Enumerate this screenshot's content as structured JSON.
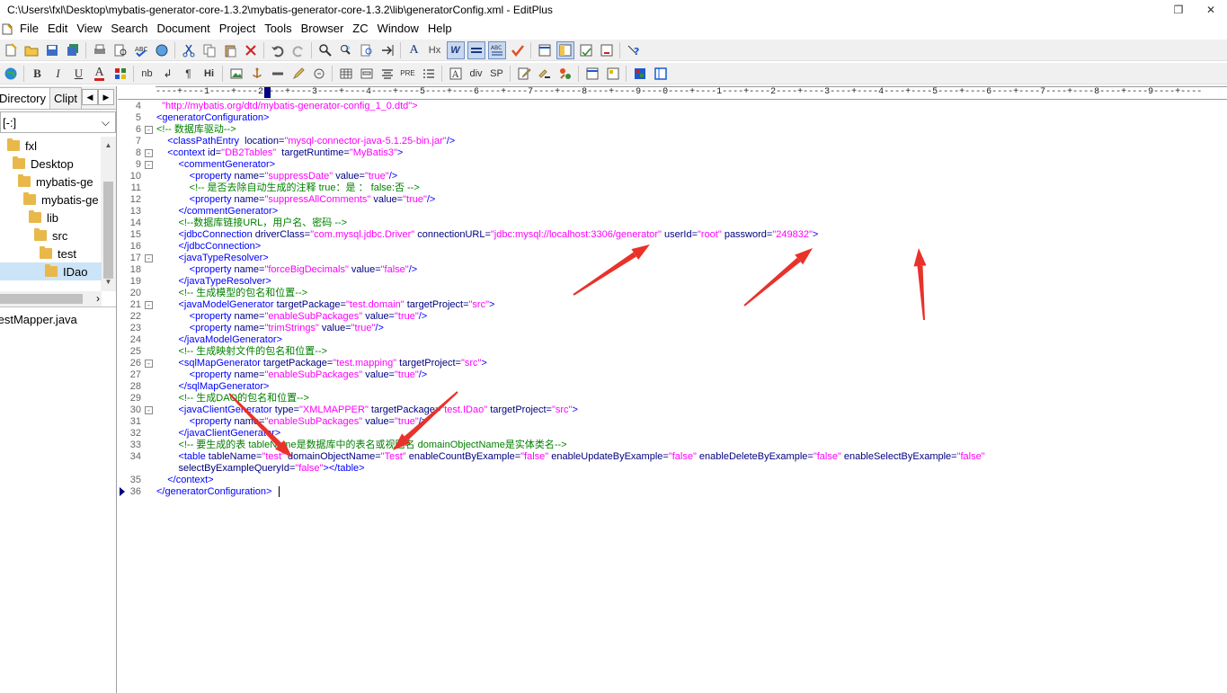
{
  "window": {
    "title": "C:\\Users\\fxl\\Desktop\\mybatis-generator-core-1.3.2\\mybatis-generator-core-1.3.2\\lib\\generatorConfig.xml - EditPlus",
    "restore_glyph": "❐",
    "close_glyph": "✕"
  },
  "menu": [
    "File",
    "Edit",
    "View",
    "Search",
    "Document",
    "Project",
    "Tools",
    "Browser",
    "ZC",
    "Window",
    "Help"
  ],
  "toolbar2_text": {
    "bold": "B",
    "italic": "I",
    "underline": "U",
    "fontcolor": "A",
    "nb": "nb",
    "return": "↲",
    "para": "¶",
    "heading": "Hi",
    "pre": "PRE",
    "div": "div",
    "sp": "SP",
    "aa": "A",
    "hx": "Hx",
    "w": "W"
  },
  "sidebar": {
    "tabs": [
      "Directory",
      "Clipt"
    ],
    "tab_prev": "◀",
    "tab_next": "▶",
    "drive": "[-:]",
    "drive_arrow": "⌵",
    "tree": [
      {
        "label": "fxl",
        "indent": 1
      },
      {
        "label": "Desktop",
        "indent": 2
      },
      {
        "label": "mybatis-ge",
        "indent": 3
      },
      {
        "label": "mybatis-ge",
        "indent": 4
      },
      {
        "label": "lib",
        "indent": 5
      },
      {
        "label": "src",
        "indent": 6
      },
      {
        "label": "test",
        "indent": 7
      },
      {
        "label": "IDao",
        "indent": 8,
        "selected": true
      }
    ],
    "scroll_up": "▲",
    "scroll_down": "▼",
    "scroll_right": "›",
    "files": [
      "testMapper.java"
    ]
  },
  "ruler": "----+----1----+----2----+----3----+----4----+----5----+----6----+----7----+----8----+----9----0----+----1----+----2----+----3----+----4----+----5----+----6----+----7----+----8----+----9----+----",
  "code": [
    {
      "n": "4",
      "fold": "",
      "parts": [
        [
          "val",
          "  \"http://mybatis.org/dtd/mybatis-generator-config_1_0.dtd\">"
        ]
      ]
    },
    {
      "n": "5",
      "fold": "",
      "parts": [
        [
          "tag",
          "<generatorConfiguration>"
        ]
      ]
    },
    {
      "n": "6",
      "fold": "⊟",
      "parts": [
        [
          "cmt",
          "<!-- 数据库驱动-->"
        ]
      ]
    },
    {
      "n": "7",
      "fold": "",
      "parts": [
        [
          "tag",
          "    <classPathEntry  "
        ],
        [
          "attr",
          "location="
        ],
        [
          "val",
          "\"mysql-connector-java-5.1.25-bin.jar\""
        ],
        [
          "tag",
          "/>"
        ]
      ]
    },
    {
      "n": "8",
      "fold": "⊟",
      "parts": [
        [
          "tag",
          "    <context "
        ],
        [
          "attr",
          "id="
        ],
        [
          "val",
          "\"DB2Tables\""
        ],
        [
          "attr",
          "  targetRuntime="
        ],
        [
          "val",
          "\"MyBatis3\""
        ],
        [
          "tag",
          ">"
        ]
      ]
    },
    {
      "n": "9",
      "fold": "⊟",
      "parts": [
        [
          "tag",
          "        <commentGenerator>"
        ]
      ]
    },
    {
      "n": "10",
      "fold": "",
      "parts": [
        [
          "tag",
          "            <property "
        ],
        [
          "attr",
          "name="
        ],
        [
          "val",
          "\"suppressDate\""
        ],
        [
          "attr",
          " value="
        ],
        [
          "val",
          "\"true\""
        ],
        [
          "tag",
          "/>"
        ]
      ]
    },
    {
      "n": "11",
      "fold": "",
      "parts": [
        [
          "cmt",
          "            <!-- 是否去除自动生成的注释 true：是 ： false:否 -->"
        ]
      ]
    },
    {
      "n": "12",
      "fold": "",
      "parts": [
        [
          "tag",
          "            <property "
        ],
        [
          "attr",
          "name="
        ],
        [
          "val",
          "\"suppressAllComments\""
        ],
        [
          "attr",
          " value="
        ],
        [
          "val",
          "\"true\""
        ],
        [
          "tag",
          "/>"
        ]
      ]
    },
    {
      "n": "13",
      "fold": "",
      "parts": [
        [
          "tag",
          "        </commentGenerator>"
        ]
      ]
    },
    {
      "n": "14",
      "fold": "",
      "parts": [
        [
          "cmt",
          "        <!--数据库链接URL，用户名、密码 -->"
        ]
      ]
    },
    {
      "n": "15",
      "fold": "",
      "parts": [
        [
          "tag",
          "        <jdbcConnection "
        ],
        [
          "attr",
          "driverClass="
        ],
        [
          "val",
          "\"com.mysql.jdbc.Driver\""
        ],
        [
          "attr",
          " connectionURL="
        ],
        [
          "val",
          "\"jdbc:mysql://localhost:3306/generator\""
        ],
        [
          "attr",
          " userId="
        ],
        [
          "val",
          "\"root\""
        ],
        [
          "attr",
          " password="
        ],
        [
          "val",
          "\"249832\""
        ],
        [
          "tag",
          ">"
        ]
      ]
    },
    {
      "n": "16",
      "fold": "",
      "parts": [
        [
          "tag",
          "        </jdbcConnection>"
        ]
      ]
    },
    {
      "n": "17",
      "fold": "⊟",
      "parts": [
        [
          "tag",
          "        <javaTypeResolver>"
        ]
      ]
    },
    {
      "n": "18",
      "fold": "",
      "parts": [
        [
          "tag",
          "            <property "
        ],
        [
          "attr",
          "name="
        ],
        [
          "val",
          "\"forceBigDecimals\""
        ],
        [
          "attr",
          " value="
        ],
        [
          "val",
          "\"false\""
        ],
        [
          "tag",
          "/>"
        ]
      ]
    },
    {
      "n": "19",
      "fold": "",
      "parts": [
        [
          "tag",
          "        </javaTypeResolver>"
        ]
      ]
    },
    {
      "n": "20",
      "fold": "",
      "parts": [
        [
          "cmt",
          "        <!-- 生成模型的包名和位置-->"
        ]
      ]
    },
    {
      "n": "21",
      "fold": "⊟",
      "parts": [
        [
          "tag",
          "        <javaModelGenerator "
        ],
        [
          "attr",
          "targetPackage="
        ],
        [
          "val",
          "\"test.domain\""
        ],
        [
          "attr",
          " targetProject="
        ],
        [
          "val",
          "\"src\""
        ],
        [
          "tag",
          ">"
        ]
      ]
    },
    {
      "n": "22",
      "fold": "",
      "parts": [
        [
          "tag",
          "            <property "
        ],
        [
          "attr",
          "name="
        ],
        [
          "val",
          "\"enableSubPackages\""
        ],
        [
          "attr",
          " value="
        ],
        [
          "val",
          "\"true\""
        ],
        [
          "tag",
          "/>"
        ]
      ]
    },
    {
      "n": "23",
      "fold": "",
      "parts": [
        [
          "tag",
          "            <property "
        ],
        [
          "attr",
          "name="
        ],
        [
          "val",
          "\"trimStrings\""
        ],
        [
          "attr",
          " value="
        ],
        [
          "val",
          "\"true\""
        ],
        [
          "tag",
          "/>"
        ]
      ]
    },
    {
      "n": "24",
      "fold": "",
      "parts": [
        [
          "tag",
          "        </javaModelGenerator>"
        ]
      ]
    },
    {
      "n": "25",
      "fold": "",
      "parts": [
        [
          "cmt",
          "        <!-- 生成映射文件的包名和位置-->"
        ]
      ]
    },
    {
      "n": "26",
      "fold": "⊟",
      "parts": [
        [
          "tag",
          "        <sqlMapGenerator "
        ],
        [
          "attr",
          "targetPackage="
        ],
        [
          "val",
          "\"test.mapping\""
        ],
        [
          "attr",
          " targetProject="
        ],
        [
          "val",
          "\"src\""
        ],
        [
          "tag",
          ">"
        ]
      ]
    },
    {
      "n": "27",
      "fold": "",
      "parts": [
        [
          "tag",
          "            <property "
        ],
        [
          "attr",
          "name="
        ],
        [
          "val",
          "\"enableSubPackages\""
        ],
        [
          "attr",
          " value="
        ],
        [
          "val",
          "\"true\""
        ],
        [
          "tag",
          "/>"
        ]
      ]
    },
    {
      "n": "28",
      "fold": "",
      "parts": [
        [
          "tag",
          "        </sqlMapGenerator>"
        ]
      ]
    },
    {
      "n": "29",
      "fold": "",
      "parts": [
        [
          "cmt",
          "        <!-- 生成DAO的包名和位置-->"
        ]
      ]
    },
    {
      "n": "30",
      "fold": "⊟",
      "parts": [
        [
          "tag",
          "        <javaClientGenerator "
        ],
        [
          "attr",
          "type="
        ],
        [
          "val",
          "\"XMLMAPPER\""
        ],
        [
          "attr",
          " targetPackage="
        ],
        [
          "val",
          "\"test.IDao\""
        ],
        [
          "attr",
          " targetProject="
        ],
        [
          "val",
          "\"src\""
        ],
        [
          "tag",
          ">"
        ]
      ]
    },
    {
      "n": "31",
      "fold": "",
      "parts": [
        [
          "tag",
          "            <property "
        ],
        [
          "attr",
          "name="
        ],
        [
          "val",
          "\"enableSubPackages\""
        ],
        [
          "attr",
          " value="
        ],
        [
          "val",
          "\"true\""
        ],
        [
          "tag",
          "/>"
        ]
      ]
    },
    {
      "n": "32",
      "fold": "",
      "parts": [
        [
          "tag",
          "        </javaClientGenerator>"
        ]
      ]
    },
    {
      "n": "33",
      "fold": "",
      "parts": [
        [
          "cmt",
          "        <!-- 要生成的表 tableName是数据库中的表名或视图名 domainObjectName是实体类名-->"
        ]
      ]
    },
    {
      "n": "34",
      "fold": "",
      "parts": [
        [
          "tag",
          "        <table "
        ],
        [
          "attr",
          "tableName="
        ],
        [
          "val",
          "\"test\""
        ],
        [
          "attr",
          " domainObjectName="
        ],
        [
          "val",
          "\"Test\""
        ],
        [
          "attr",
          " enableCountByExample="
        ],
        [
          "val",
          "\"false\""
        ],
        [
          "attr",
          " enableUpdateByExample="
        ],
        [
          "val",
          "\"false\""
        ],
        [
          "attr",
          " enableDeleteByExample="
        ],
        [
          "val",
          "\"false\""
        ],
        [
          "attr",
          " enableSelectByExample="
        ],
        [
          "val",
          "\"false\""
        ]
      ]
    },
    {
      "n": "",
      "fold": "",
      "parts": [
        [
          "attr",
          "        selectByExampleQueryId="
        ],
        [
          "val",
          "\"false\""
        ],
        [
          "tag",
          "></table>"
        ]
      ]
    },
    {
      "n": "35",
      "fold": "",
      "parts": [
        [
          "tag",
          "    </context>"
        ]
      ]
    },
    {
      "n": "36",
      "fold": "",
      "caret": true,
      "parts": [
        [
          "tag",
          "</generatorConfiguration>"
        ]
      ]
    }
  ],
  "colors": {
    "arrow": "#e8322a",
    "tag": "#0000ff",
    "attr": "#000080",
    "value": "#ff00ff",
    "comment": "#008000"
  }
}
